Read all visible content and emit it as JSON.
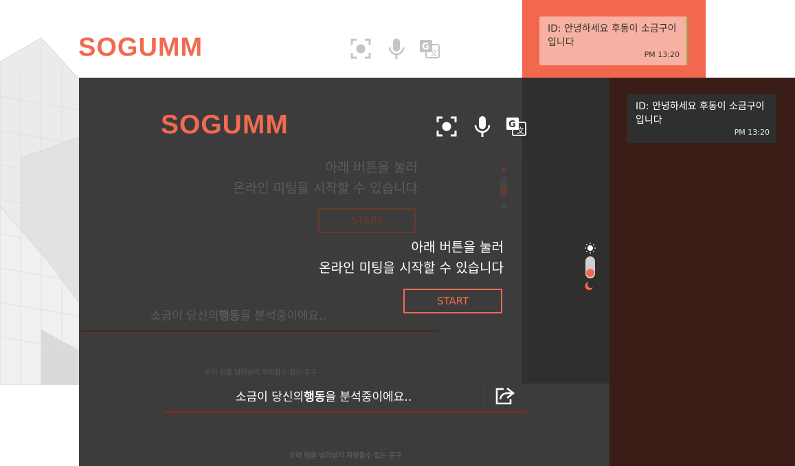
{
  "brand": {
    "logo": "SOGUMM",
    "accent": "#f26a50"
  },
  "toolbar": {
    "icons": [
      "focus-icon",
      "microphone-icon",
      "translate-icon"
    ]
  },
  "chat": {
    "message": "ID: 안녕하세요 후동이 소금구이 입니다",
    "time": "PM 13:20"
  },
  "main": {
    "instruction_line1": "아래 버튼을 눌러",
    "instruction_line2": "온라인 미팅을 시작할 수 있습니다",
    "start_label": "START"
  },
  "theme_toggle": {
    "icons": [
      "sun-icon",
      "moon-icon"
    ]
  },
  "status": {
    "prefix": "소금이 당신의 ",
    "emphasis": "행동",
    "suffix": "을 분석중이에요.."
  },
  "footer": {
    "text": "우리 팀을 널리널리 자랑할수 있는 문구"
  }
}
